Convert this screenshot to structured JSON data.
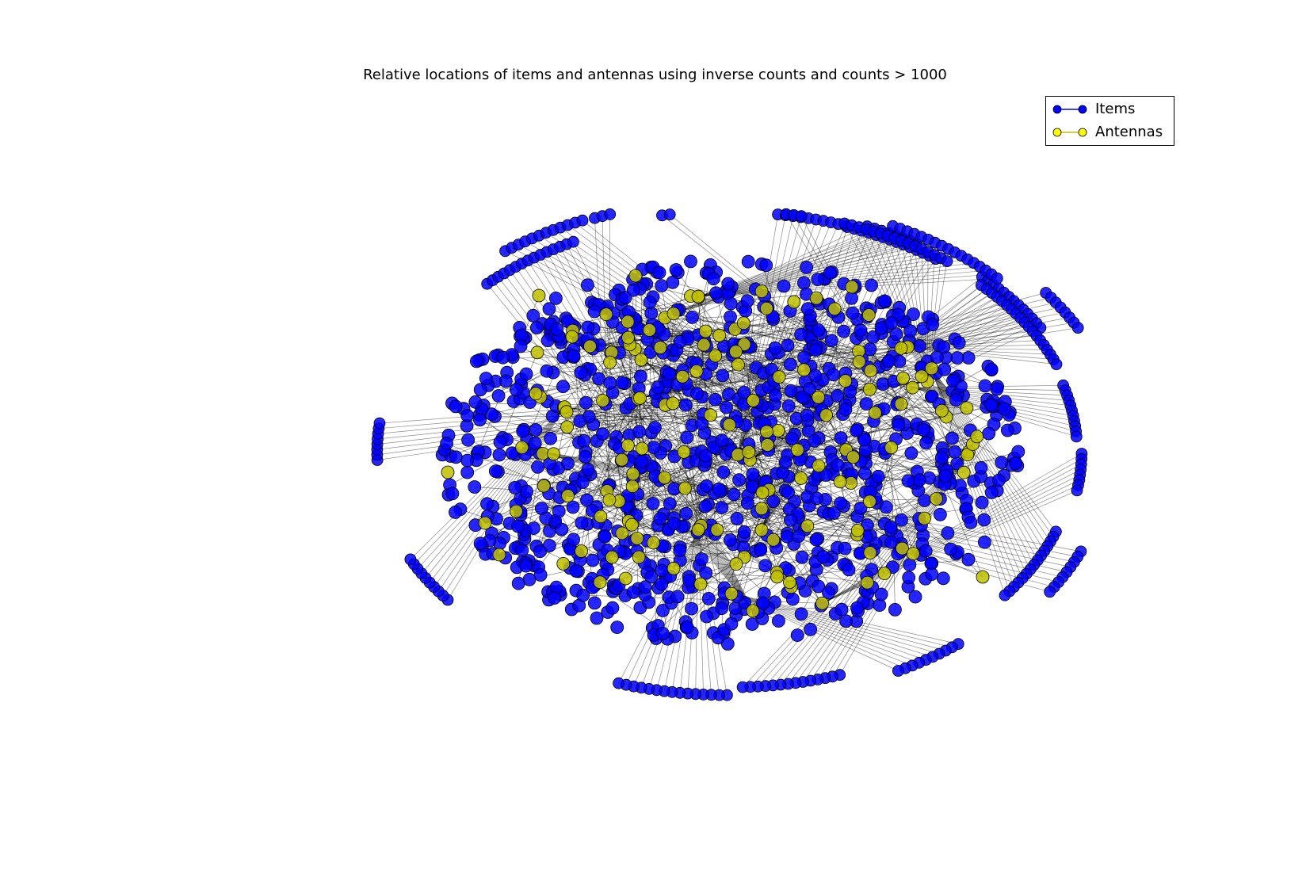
{
  "chart_data": {
    "type": "network-graph",
    "title": "Relative locations of items and antennas using inverse counts and counts > 1000",
    "legend_placement": "top-right",
    "axes_visible": false,
    "series": [
      {
        "name": "Items",
        "color": "#0000ff",
        "edge_color": "#000000"
      },
      {
        "name": "Antennas",
        "color": "#bfbf00",
        "edge_color": "#000000"
      }
    ]
  }
}
